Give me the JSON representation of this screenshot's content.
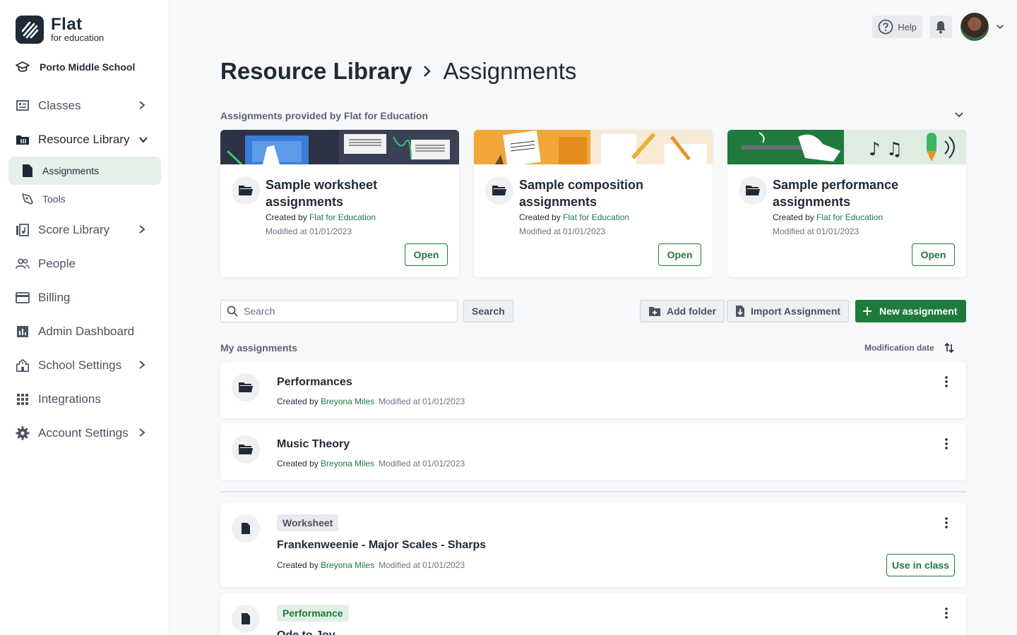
{
  "brand": {
    "title": "Flat",
    "subtitle": "for education"
  },
  "school": {
    "name": "Porto Middle School"
  },
  "sidebar": {
    "items": [
      {
        "label": "Classes",
        "icon": "classes-icon"
      },
      {
        "label": "Resource Library",
        "icon": "library-icon"
      },
      {
        "label": "Assignments",
        "icon": "document-icon"
      },
      {
        "label": "Tools",
        "icon": "pen-tool-icon"
      },
      {
        "label": "Score Library",
        "icon": "score-library-icon"
      },
      {
        "label": "People",
        "icon": "people-icon"
      },
      {
        "label": "Billing",
        "icon": "billing-icon"
      },
      {
        "label": "Admin Dashboard",
        "icon": "chart-icon"
      },
      {
        "label": "School Settings",
        "icon": "school-icon"
      },
      {
        "label": "Integrations",
        "icon": "grid-icon"
      },
      {
        "label": "Account Settings",
        "icon": "gear-icon"
      }
    ]
  },
  "topbar": {
    "help_label": "Help"
  },
  "breadcrumb": {
    "parent": "Resource Library",
    "current": "Assignments"
  },
  "provided": {
    "title": "Assignments provided by Flat for Education",
    "cards": [
      {
        "title": "Sample worksheet assignments",
        "created_prefix": "Created by",
        "author": "Flat for Education",
        "modified": "Modified at 01/01/2023",
        "open_label": "Open"
      },
      {
        "title": "Sample composition assignments",
        "created_prefix": "Created by",
        "author": "Flat for Education",
        "modified": "Modified at 01/01/2023",
        "open_label": "Open"
      },
      {
        "title": "Sample performance assignments",
        "created_prefix": "Created by",
        "author": "Flat for Education",
        "modified": "Modified at 01/01/2023",
        "open_label": "Open"
      }
    ]
  },
  "toolbar": {
    "search_placeholder": "Search",
    "search_button": "Search",
    "add_folder": "Add folder",
    "import_assignment": "Import Assignment",
    "new_assignment": "New assignment"
  },
  "my_assignments": {
    "title": "My assignments",
    "sort_label": "Modification date",
    "folders": [
      {
        "title": "Performances",
        "created_prefix": "Created by",
        "author": "Breyona Miles",
        "modified": "Modified at 01/01/2023"
      },
      {
        "title": "Music Theory",
        "created_prefix": "Created by",
        "author": "Breyona Miles",
        "modified": "Modified at 01/01/2023"
      }
    ],
    "assignments": [
      {
        "tag": "Worksheet",
        "title": "Frankenweenie - Major Scales - Sharps",
        "created_prefix": "Created by",
        "author": "Breyona Miles",
        "modified": "Modified at 01/01/2023",
        "action": "Use in class"
      },
      {
        "tag": "Performance",
        "title": "Ode to Joy"
      }
    ]
  },
  "colors": {
    "accent": "#1f7a3d",
    "text": "#1f2a37",
    "muted": "#5b6472"
  }
}
